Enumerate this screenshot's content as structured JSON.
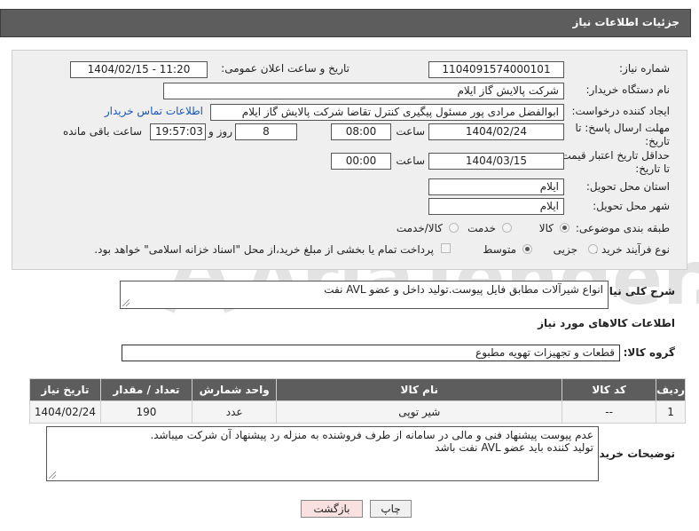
{
  "header": {
    "title": "جزئیات اطلاعات نیاز"
  },
  "form": {
    "need_number_label": "شماره نیاز:",
    "need_number": "1104091574000101",
    "announce_label": "تاریخ و ساعت اعلان عمومی:",
    "announce_value": "1404/02/15 - 11:20",
    "buyer_org_label": "نام دستگاه خریدار:",
    "buyer_org": "شرکت پالایش گاز ایلام",
    "requester_label": "ایجاد کننده درخواست:",
    "requester": "ابوالفضل مرادی پور مسئول پیگیری کنترل تقاضا شرکت پالایش گاز ایلام",
    "contact_link": "اطلاعات تماس خریدار",
    "deadline_label_1": "مهلت ارسال پاسخ: تا",
    "deadline_label_2": "تاریخ:",
    "deadline_date": "1404/02/24",
    "time_label": "ساعت",
    "deadline_time": "08:00",
    "days_value": "8",
    "days_label": "روز و",
    "remaining_time": "19:57:03",
    "remaining_label": "ساعت باقی مانده",
    "validity_label_1": "حداقل تاریخ اعتبار قیمت:",
    "validity_label_2": "تا تاریخ:",
    "validity_date": "1404/03/15",
    "validity_time": "00:00",
    "province_label": "استان محل تحویل:",
    "province": "ایلام",
    "city_label": "شهر محل تحویل:",
    "city": "ایلام",
    "category_label": "طبقه بندی موضوعی:",
    "category_options": [
      "کالا",
      "خدمت",
      "کالا/خدمت"
    ],
    "process_label": "نوع فرآیند خرید :",
    "process_options": [
      "جزیی",
      "متوسط"
    ],
    "payment_note": "پرداخت تمام یا بخشی از مبلغ خرید،از محل \"اسناد خزانه اسلامی\" خواهد بود."
  },
  "summary": {
    "label": "شرح کلی نیاز:",
    "text": "انواع شیرآلات مطابق فایل پیوست.تولید داخل و عضو AVL نفت"
  },
  "goods": {
    "section_title": "اطلاعات کالاهای مورد نیاز",
    "group_label": "گروه کالا:",
    "group_value": "قطعات و تجهیزات تهویه مطبوع",
    "columns": [
      "ردیف",
      "کد کالا",
      "نام کالا",
      "واحد شمارش",
      "تعداد / مقدار",
      "تاریخ نیاز"
    ],
    "rows": [
      {
        "row": "1",
        "code": "--",
        "name": "شیر توپی",
        "unit": "عدد",
        "qty": "190",
        "date": "1404/02/24"
      }
    ]
  },
  "notes": {
    "label": "توضیحات خریدار:",
    "line1": "عدم پیوست پیشنهاد فنی و مالی در سامانه از طرف فروشنده به منزله رد پیشنهاد آن شرکت میباشد.",
    "line2": "تولید کننده باید عضو AVL نفت باشد"
  },
  "buttons": {
    "print": "چاپ",
    "back": "بازگشت"
  },
  "watermark": "AriaTender.net",
  "colors": {
    "header_bg": "#5d5d5d",
    "panel_bg": "#efefef",
    "link": "#1a55b8",
    "back_button": "#f9e1e1"
  }
}
